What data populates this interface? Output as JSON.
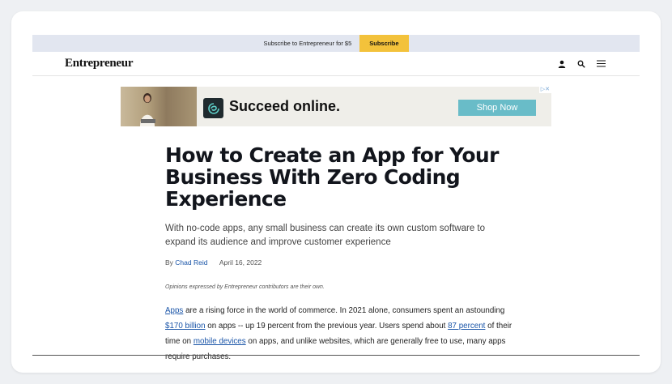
{
  "promo": {
    "text": "Subscribe to Entrepreneur for $5",
    "button": "Subscribe"
  },
  "nav": {
    "logo": "Entrepreneur",
    "icons": [
      "user-icon",
      "search-icon",
      "menu-icon"
    ]
  },
  "ad": {
    "headline": "Succeed online.",
    "cta": "Shop Now",
    "corner": "▷✕"
  },
  "article": {
    "headline": "How to Create an App for Your Business With Zero Coding Experience",
    "dek": "With no-code apps, any small business can create its own custom software to expand its audience and improve customer experience",
    "byline_prefix": "By ",
    "author": "Chad Reid",
    "date": "April 16, 2022",
    "disclaimer": "Opinions expressed by Entrepreneur contributors are their own.",
    "body": {
      "link1": "Apps",
      "t1": " are a rising force in the world of commerce. In 2021 alone, consumers spent an astounding ",
      "link2": "$170 billion",
      "t2": " on apps -- up 19 percent from the previous year. Users spend about ",
      "link3": "87 percent",
      "t3": " of their time on ",
      "link4": "mobile devices",
      "t4": " on apps, and unlike websites, which are generally free to use, many apps require purchases."
    }
  },
  "colors": {
    "promo_bg": "#e2e6f0",
    "subscribe_btn": "#f3c23b",
    "link": "#1a55a8",
    "cta": "#69bcc8"
  }
}
